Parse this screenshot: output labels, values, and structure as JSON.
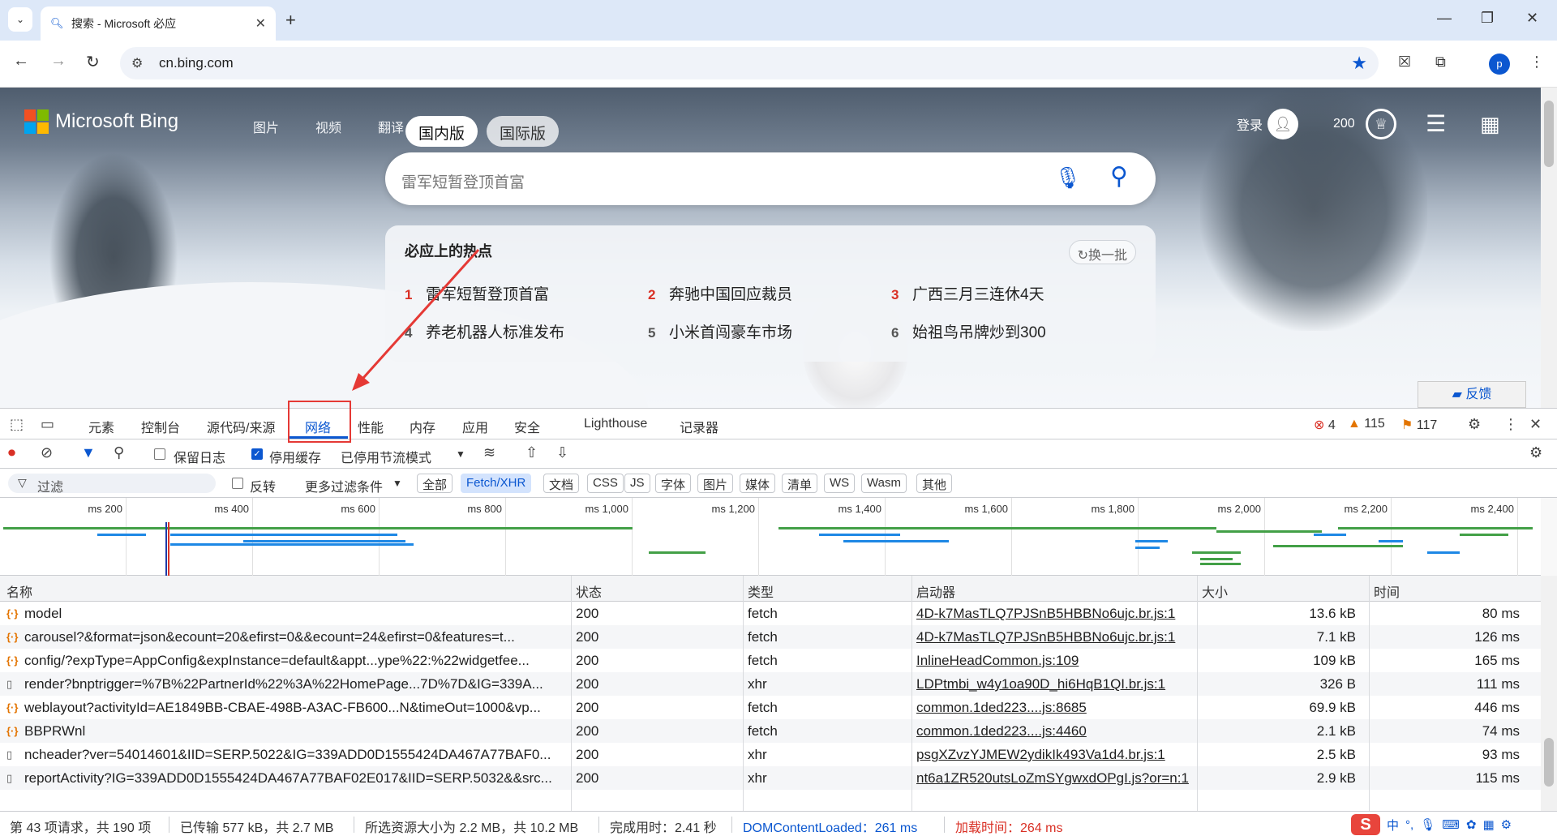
{
  "browser": {
    "tab_title": "搜索 - Microsoft 必应",
    "url": "cn.bing.com",
    "profile_initial": "p"
  },
  "bing": {
    "brand": "Microsoft Bing",
    "nav": [
      "图片",
      "视频",
      "翻译"
    ],
    "region_tabs": [
      "国内版",
      "国际版"
    ],
    "search_placeholder": "雷军短暂登顶首富",
    "hot_title": "必应上的热点",
    "refresh_label": "换一批",
    "hot_items": [
      {
        "num": "1",
        "text": "雷军短暂登顶首富"
      },
      {
        "num": "2",
        "text": "奔驰中国回应裁员"
      },
      {
        "num": "3",
        "text": "广西三月三连休4天"
      },
      {
        "num": "4",
        "text": "养老机器人标准发布"
      },
      {
        "num": "5",
        "text": "小米首闯豪车市场"
      },
      {
        "num": "6",
        "text": "始祖鸟吊牌炒到300"
      }
    ],
    "login_label": "登录",
    "points": "200",
    "feedback_label": "反馈"
  },
  "devtools": {
    "tabs": [
      "元素",
      "控制台",
      "源代码/来源",
      "网络",
      "性能",
      "内存",
      "应用",
      "安全",
      "Lighthouse",
      "记录器"
    ],
    "errors": "4",
    "warnings": "115",
    "issues": "117",
    "toolbar": {
      "preserve_log": "保留日志",
      "disable_cache": "停用缓存",
      "throttle": "已停用节流模式"
    },
    "filter": {
      "placeholder": "过滤",
      "invert": "反转",
      "more_filters": "更多过滤条件",
      "chips": [
        "全部",
        "Fetch/XHR",
        "文档",
        "CSS",
        "JS",
        "字体",
        "图片",
        "媒体",
        "清单",
        "WS",
        "Wasm",
        "其他"
      ]
    },
    "timeline_ticks": [
      "200 ms",
      "400 ms",
      "600 ms",
      "800 ms",
      "1,000 ms",
      "1,200 ms",
      "1,400 ms",
      "1,600 ms",
      "1,800 ms",
      "2,000 ms",
      "2,200 ms",
      "2,400 ms"
    ],
    "columns": [
      "名称",
      "状态",
      "类型",
      "启动器",
      "大小",
      "时间"
    ],
    "rows": [
      {
        "name": "model",
        "status": "200",
        "type": "fetch",
        "initiator": "4D-k7MasTLQ7PJSnB5HBBNo6ujc.br.js:1",
        "size": "13.6 kB",
        "time": "80 ms",
        "icon": "fetch"
      },
      {
        "name": "carousel?&format=json&ecount=20&efirst=0&&ecount=24&efirst=0&features=t...",
        "status": "200",
        "type": "fetch",
        "initiator": "4D-k7MasTLQ7PJSnB5HBBNo6ujc.br.js:1",
        "size": "7.1 kB",
        "time": "126 ms",
        "icon": "fetch"
      },
      {
        "name": "config/?expType=AppConfig&expInstance=default&appt...ype%22:%22widgetfee...",
        "status": "200",
        "type": "fetch",
        "initiator": "InlineHeadCommon.js:109",
        "size": "109 kB",
        "time": "165 ms",
        "icon": "fetch"
      },
      {
        "name": "render?bnptrigger=%7B%22PartnerId%22%3A%22HomePage...7D%7D&IG=339A...",
        "status": "200",
        "type": "xhr",
        "initiator": "LDPtmbi_w4y1oa90D_hi6HqB1QI.br.js:1",
        "size": "326 B",
        "time": "111 ms",
        "icon": "doc"
      },
      {
        "name": "weblayout?activityId=AE1849BB-CBAE-498B-A3AC-FB600...N&timeOut=1000&vp...",
        "status": "200",
        "type": "fetch",
        "initiator": "common.1ded223....js:8685",
        "size": "69.9 kB",
        "time": "446 ms",
        "icon": "fetch"
      },
      {
        "name": "BBPRWnl",
        "status": "200",
        "type": "fetch",
        "initiator": "common.1ded223....js:4460",
        "size": "2.1 kB",
        "time": "74 ms",
        "icon": "fetch"
      },
      {
        "name": "ncheader?ver=54014601&IID=SERP.5022&IG=339ADD0D1555424DA467A77BAF0...",
        "status": "200",
        "type": "xhr",
        "initiator": "psgXZvzYJMEW2ydikIk493Va1d4.br.js:1",
        "size": "2.5 kB",
        "time": "93 ms",
        "icon": "doc"
      },
      {
        "name": "reportActivity?IG=339ADD0D1555424DA467A77BAF02E017&IID=SERP.5032&&src...",
        "status": "200",
        "type": "xhr",
        "initiator": "nt6a1ZR520utsLoZmSYgwxdOPgI.js?or=n:1",
        "size": "2.9 kB",
        "time": "115 ms",
        "icon": "doc"
      }
    ],
    "status": {
      "requests": "第 43 项请求，共 190 项",
      "transferred": "已传输 577 kB，共 2.7 MB",
      "resources": "所选资源大小为 2.2 MB，共 10.2 MB",
      "finish": "完成用时：2.41 秒",
      "dcl": "DOMContentLoaded：261 ms",
      "load": "加载时间：264 ms"
    }
  },
  "ime": {
    "lang": "中"
  },
  "colors": {
    "accent": "#0b57d0",
    "error": "#d93025",
    "annotation": "#e53935"
  }
}
